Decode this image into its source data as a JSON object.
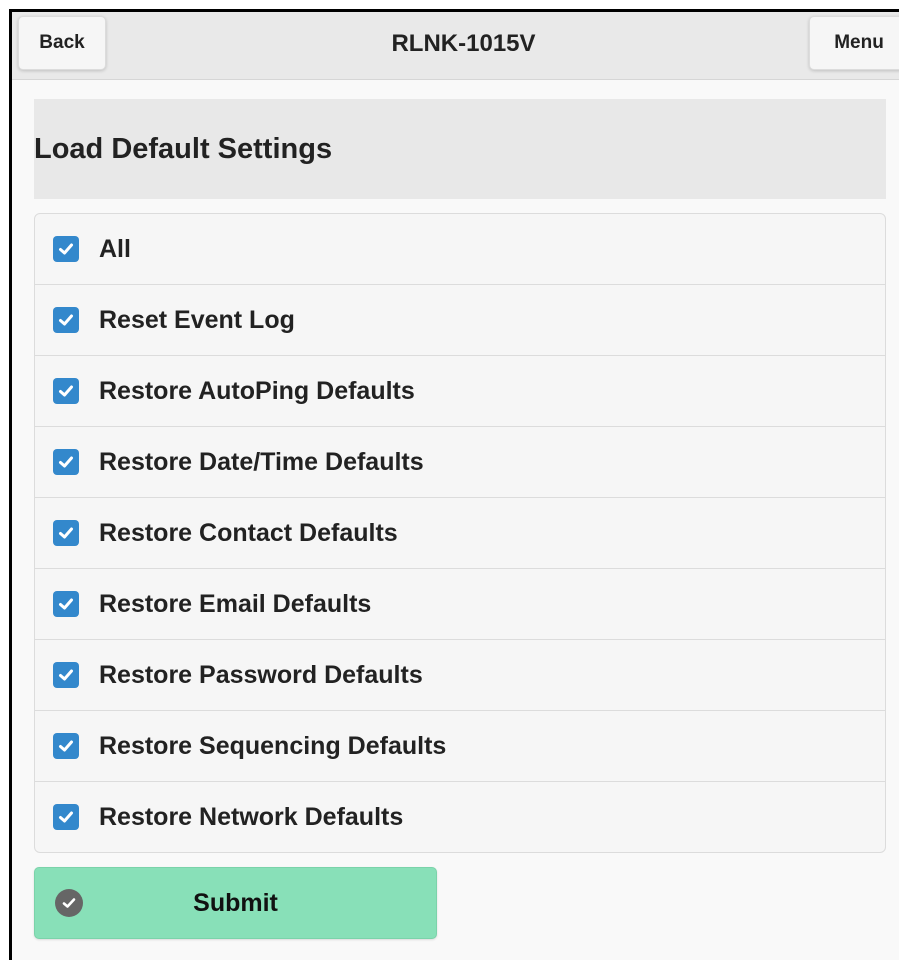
{
  "header": {
    "back_label": "Back",
    "title": "RLNK-1015V",
    "menu_label": "Menu"
  },
  "section": {
    "title": "Load Default Settings"
  },
  "options": [
    {
      "label": "All",
      "checked": true
    },
    {
      "label": "Reset Event Log",
      "checked": true
    },
    {
      "label": "Restore AutoPing Defaults",
      "checked": true
    },
    {
      "label": "Restore Date/Time Defaults",
      "checked": true
    },
    {
      "label": "Restore Contact Defaults",
      "checked": true
    },
    {
      "label": "Restore Email Defaults",
      "checked": true
    },
    {
      "label": "Restore Password Defaults",
      "checked": true
    },
    {
      "label": "Restore Sequencing Defaults",
      "checked": true
    },
    {
      "label": "Restore Network Defaults",
      "checked": true
    }
  ],
  "submit": {
    "label": "Submit",
    "icon": "check-circle-icon",
    "color": "#88e0b8"
  },
  "colors": {
    "checkbox": "#3388cc",
    "header_bg": "#e9e9e9"
  }
}
